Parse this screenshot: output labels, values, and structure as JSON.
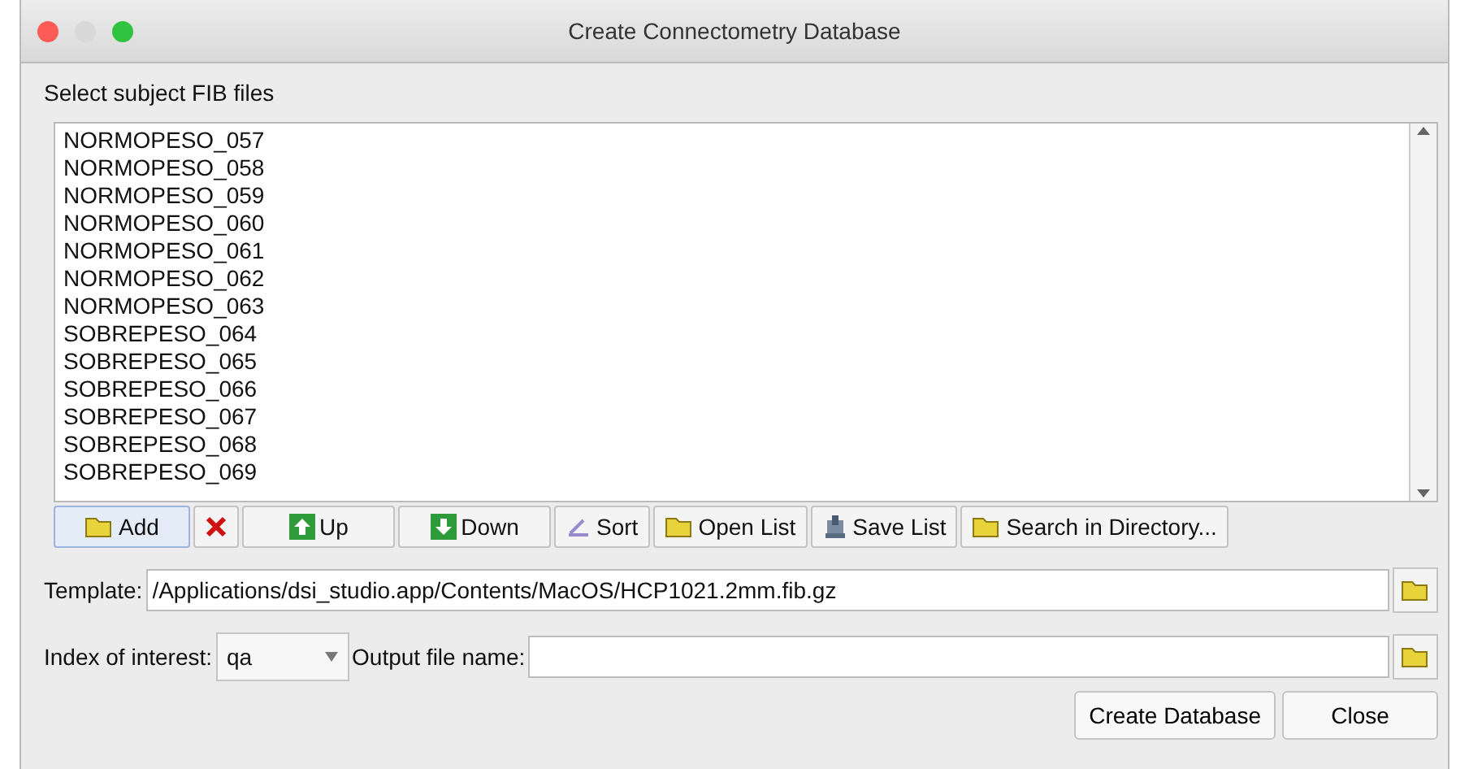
{
  "window": {
    "title": "Create Connectometry Database"
  },
  "files_label": "Select subject FIB files",
  "files": [
    "NORMOPESO_057",
    "NORMOPESO_058",
    "NORMOPESO_059",
    "NORMOPESO_060",
    "NORMOPESO_061",
    "NORMOPESO_062",
    "NORMOPESO_063",
    "SOBREPESO_064",
    "SOBREPESO_065",
    "SOBREPESO_066",
    "SOBREPESO_067",
    "SOBREPESO_068",
    "SOBREPESO_069"
  ],
  "list_buttons": [
    {
      "label": "Add",
      "focused": true
    },
    {
      "focused": false
    },
    {
      "label": "Up",
      "focused": false
    },
    {
      "label": "Down",
      "focused": false
    },
    {
      "label": "Sort",
      "focused": false
    },
    {
      "label": "Open List",
      "focused": false
    },
    {
      "label": "Save List",
      "focused": false
    },
    {
      "label": "Search in Directory...",
      "focused": false
    }
  ],
  "template": {
    "label": "Template:",
    "value": "/Applications/dsi_studio.app/Contents/MacOS/HCP1021.2mm.fib.gz"
  },
  "index": {
    "label": "Index of interest:",
    "value": "qa"
  },
  "output": {
    "label": "Output file name:"
  },
  "buttons": [
    "Create Database",
    "Close"
  ]
}
